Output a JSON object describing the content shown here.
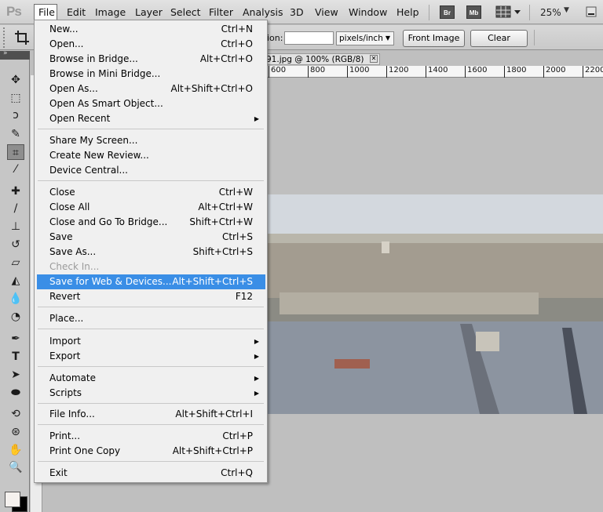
{
  "menubar": {
    "logo": "Ps",
    "items": [
      "File",
      "Edit",
      "Image",
      "Layer",
      "Select",
      "Filter",
      "Analysis",
      "3D",
      "View",
      "Window",
      "Help"
    ],
    "bridge_btn": "Br",
    "minibridge_btn": "Mb",
    "zoom": "25%"
  },
  "options": {
    "resolution_label": "ion:",
    "resolution_value": "",
    "unit": "pixels/inch",
    "front_image_label": "Front Image",
    "clear_label": "Clear"
  },
  "document": {
    "tab_title": "91.jpg @ 100% (RGB/8)",
    "ruler_ticks": [
      "600",
      "800",
      "1000",
      "1200",
      "1400",
      "1600",
      "1800",
      "2000",
      "2200"
    ]
  },
  "file_menu": {
    "items": [
      {
        "label": "New...",
        "shortcut": "Ctrl+N"
      },
      {
        "label": "Open...",
        "shortcut": "Ctrl+O"
      },
      {
        "label": "Browse in Bridge...",
        "shortcut": "Alt+Ctrl+O"
      },
      {
        "label": "Browse in Mini Bridge...",
        "shortcut": ""
      },
      {
        "label": "Open As...",
        "shortcut": "Alt+Shift+Ctrl+O"
      },
      {
        "label": "Open As Smart Object...",
        "shortcut": ""
      },
      {
        "label": "Open Recent",
        "shortcut": ""
      },
      {
        "label": "Share My Screen...",
        "shortcut": ""
      },
      {
        "label": "Create New Review...",
        "shortcut": ""
      },
      {
        "label": "Device Central...",
        "shortcut": ""
      },
      {
        "label": "Close",
        "shortcut": "Ctrl+W"
      },
      {
        "label": "Close All",
        "shortcut": "Alt+Ctrl+W"
      },
      {
        "label": "Close and Go To Bridge...",
        "shortcut": "Shift+Ctrl+W"
      },
      {
        "label": "Save",
        "shortcut": "Ctrl+S"
      },
      {
        "label": "Save As...",
        "shortcut": "Shift+Ctrl+S"
      },
      {
        "label": "Check In...",
        "shortcut": ""
      },
      {
        "label": "Save for Web & Devices...",
        "shortcut": "Alt+Shift+Ctrl+S"
      },
      {
        "label": "Revert",
        "shortcut": "F12"
      },
      {
        "label": "Place...",
        "shortcut": ""
      },
      {
        "label": "Import",
        "shortcut": ""
      },
      {
        "label": "Export",
        "shortcut": ""
      },
      {
        "label": "Automate",
        "shortcut": ""
      },
      {
        "label": "Scripts",
        "shortcut": ""
      },
      {
        "label": "File Info...",
        "shortcut": "Alt+Shift+Ctrl+I"
      },
      {
        "label": "Print...",
        "shortcut": "Ctrl+P"
      },
      {
        "label": "Print One Copy",
        "shortcut": "Alt+Shift+Ctrl+P"
      },
      {
        "label": "Exit",
        "shortcut": "Ctrl+Q"
      }
    ],
    "highlighted": "Save for Web & Devices...",
    "disabled": [
      "Check In..."
    ],
    "submenus": [
      "Open Recent",
      "Import",
      "Export",
      "Automate",
      "Scripts"
    ]
  },
  "colors": {
    "highlight": "#3a8ee6",
    "foreground_swatch": "#f5f1ee",
    "background_swatch": "#000000"
  },
  "tools": [
    "move-tool",
    "marquee-tool",
    "lasso-tool",
    "quick-selection-tool",
    "crop-tool",
    "eyedropper-tool",
    "healing-brush-tool",
    "brush-tool",
    "clone-stamp-tool",
    "history-brush-tool",
    "eraser-tool",
    "paint-bucket-tool",
    "blur-tool",
    "dodge-tool",
    "pen-tool",
    "type-tool",
    "path-selection-tool",
    "shape-tool",
    "rotate-3d-tool",
    "orbit-3d-tool",
    "hand-tool",
    "zoom-tool"
  ]
}
